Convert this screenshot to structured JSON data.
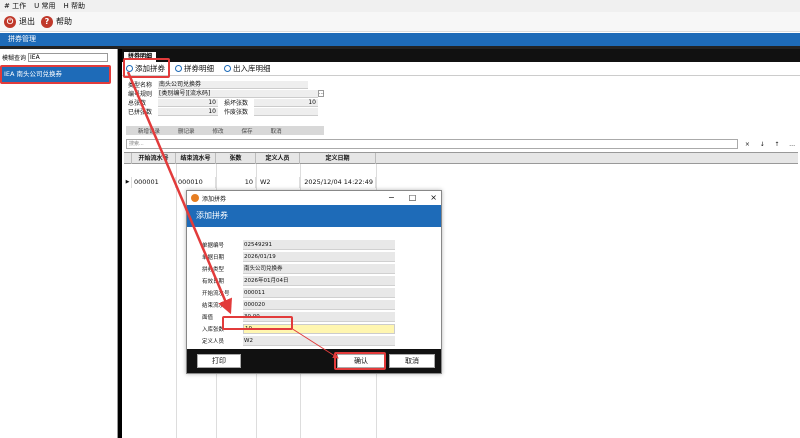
{
  "menu": {
    "items": [
      "# 工作",
      "U 常用",
      "H 帮助"
    ]
  },
  "toolbar": {
    "exit_label": "退出",
    "help_label": "帮助"
  },
  "window_title": "拼券管理",
  "left": {
    "fuzzy_label": "模糊查询",
    "fuzzy_value": "IEA",
    "tree_item": "IEA  南头公司兑换券"
  },
  "tab": {
    "label": "拼券明细"
  },
  "subbar": {
    "add_label": "添加拼券",
    "detail_label": "拼券明细",
    "inout_label": "出入库明细"
  },
  "form": {
    "type_label": "类型名称",
    "type_value": "南头公司兑换券",
    "rule_label": "编号规则",
    "rule_value": "[类别编号][流水码]",
    "total_label": "总张数",
    "total_value": "10",
    "damaged_label": "损坏张数",
    "damaged_value": "10",
    "used_label": "已拼张数",
    "used_value": "10",
    "void_label": "作废张数",
    "void_value": ""
  },
  "nav": {
    "items": [
      "新增记录",
      "删记录",
      "修改",
      "保存",
      "取消"
    ]
  },
  "search": {
    "placeholder": "搜索..."
  },
  "searchbtns": [
    "×",
    "↓",
    "↑",
    "…"
  ],
  "grid": {
    "headers": [
      "开始流水号",
      "结束流水号",
      "张数",
      "定义人员",
      "定义日期"
    ],
    "row": [
      "000001",
      "000010",
      "10",
      "W2",
      "2025/12/04 14:22:49"
    ]
  },
  "dialog": {
    "window_title": "添加拼券",
    "header": "添加拼券",
    "fields": [
      {
        "label": "单据编号",
        "value": "02549291"
      },
      {
        "label": "单据日期",
        "value": "2026/01/19"
      },
      {
        "label": "拼券类型",
        "value": "南头公司兑换券"
      },
      {
        "label": "有效日期",
        "value": "2026年01月04日"
      },
      {
        "label": "开始流水号",
        "value": "000011"
      },
      {
        "label": "结束流水号",
        "value": "000020"
      },
      {
        "label": "面值",
        "value": "30.00"
      }
    ],
    "qty_label": "入库张数",
    "qty_value": "10",
    "creator_label": "定义人员",
    "creator_value": "W2",
    "print_label": "打印",
    "ok_label": "确认",
    "cancel_label": "取消"
  },
  "colors": {
    "accent": "#1e6bb8",
    "highlight": "#e23b3b",
    "input_yellow": "#fff6b0"
  }
}
